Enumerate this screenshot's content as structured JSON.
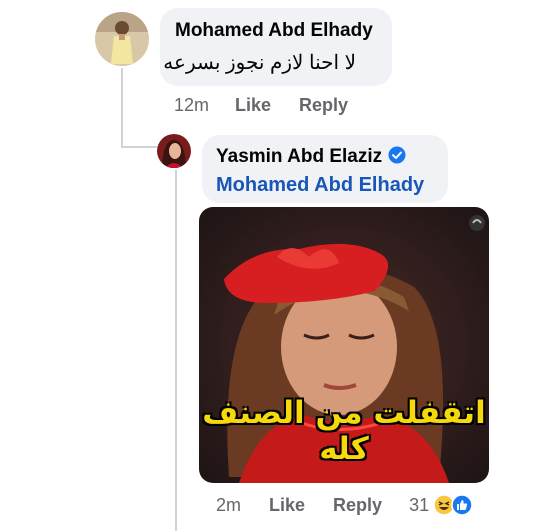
{
  "comments": [
    {
      "author": "Mohamed Abd Elhady",
      "text": "لا احنا لازم نجوز بسرعه",
      "time": "12m",
      "like_label": "Like",
      "reply_label": "Reply"
    }
  ],
  "reply": {
    "author": "Yasmin Abd Elaziz",
    "verified_icon": "verified-badge-icon",
    "mention": "Mohamed Abd Elhady",
    "image_caption": "اتقفلت من الصنف كله",
    "time": "2m",
    "like_label": "Like",
    "reply_label": "Reply",
    "reaction_count": "31",
    "reaction_icons": [
      "haha-reaction-icon",
      "like-reaction-icon"
    ]
  },
  "colors": {
    "bubble_bg": "#f0f2f5",
    "mention": "#1a56b8",
    "meta_text": "#65676b",
    "verified": "#1877f2",
    "caption": "#f5d90a"
  }
}
